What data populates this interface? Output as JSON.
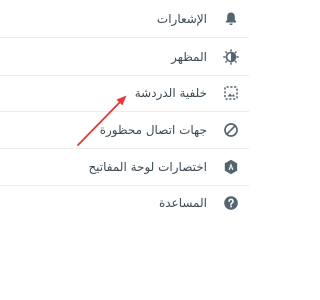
{
  "menu": {
    "items": [
      {
        "label": "الإشعارات",
        "icon": "bell-icon"
      },
      {
        "label": "المظهر",
        "icon": "theme-icon"
      },
      {
        "label": "خلفية الدردشة",
        "icon": "wallpaper-icon"
      },
      {
        "label": "جهات اتصال محظورة",
        "icon": "block-icon"
      },
      {
        "label": "اختصارات لوحة المفاتيح",
        "icon": "keyboard-shortcuts-icon"
      },
      {
        "label": "المساعدة",
        "icon": "help-icon"
      }
    ]
  },
  "colors": {
    "text": "#3b4a54",
    "icon": "#54656f",
    "divider": "#ececec",
    "annotation_arrow": "#e53935"
  }
}
